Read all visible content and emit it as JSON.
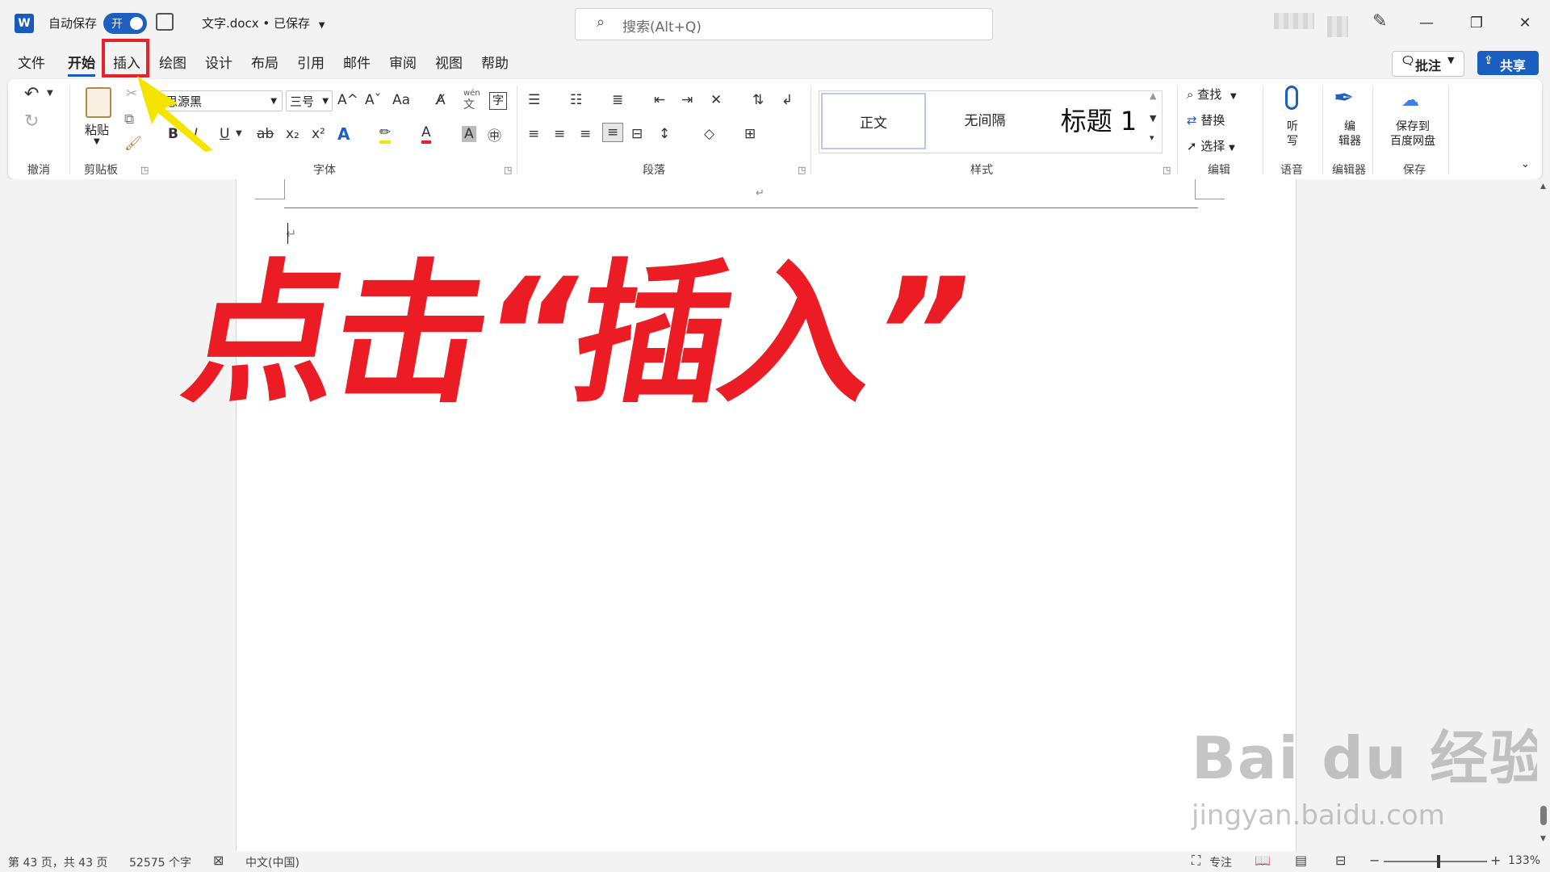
{
  "titlebar": {
    "app_icon": "word-icon",
    "app_icon_letter": "W",
    "autosave_label": "自动保存",
    "autosave_state": "开",
    "doc_title": "文字.docx • 已保存",
    "search_placeholder": "搜索(Alt+Q)",
    "minimize": "—",
    "restore": "❐",
    "close": "✕"
  },
  "tabs": [
    {
      "label": "文件"
    },
    {
      "label": "开始",
      "active": true
    },
    {
      "label": "插入"
    },
    {
      "label": "绘图"
    },
    {
      "label": "设计"
    },
    {
      "label": "布局"
    },
    {
      "label": "引用"
    },
    {
      "label": "邮件"
    },
    {
      "label": "审阅"
    },
    {
      "label": "视图"
    },
    {
      "label": "帮助"
    }
  ],
  "actions": {
    "comments": "批注",
    "share": "共享"
  },
  "ribbon": {
    "groups": {
      "undo": "撤消",
      "clipboard": "剪贴板",
      "font": "字体",
      "paragraph": "段落",
      "styles": "样式",
      "editing": "编辑",
      "voice": "语音",
      "editor": "编辑器",
      "save": "保存"
    },
    "paste_label": "粘贴",
    "font_name": "思源黑",
    "font_size": "三号",
    "grow_font_glyph": "A^",
    "shrink_font_glyph": "Aˇ",
    "change_case_glyph": "Aa",
    "phonetic_top": "wén",
    "phonetic_bottom": "文",
    "bold_glyph": "B",
    "italic_glyph": "I",
    "underline_glyph": "U",
    "strike_glyph": "ab",
    "subscript_glyph": "x₂",
    "superscript_glyph": "x²",
    "text_effect_glyph": "A",
    "font_color_glyph": "A",
    "char_shading_glyph": "A",
    "enclose_glyph": "字",
    "styles": [
      "正文",
      "无间隔",
      "标题 1"
    ],
    "find": "查找",
    "replace": "替换",
    "select": "选择",
    "dictate_l1": "听",
    "dictate_l2": "写",
    "editor_l1": "编",
    "editor_l2": "辑器",
    "save_cloud_l1": "保存到",
    "save_cloud_l2": "百度网盘"
  },
  "document": {
    "headline": "点击“插入”",
    "pilcrow": "↵"
  },
  "statusbar": {
    "page": "第 43 页，共 43 页",
    "words": "52575 个字",
    "language": "中文(中国)",
    "focus": "专注",
    "zoom": "133%",
    "zoom_minus": "−",
    "zoom_plus": "+"
  },
  "watermark": {
    "brand": "Bai du 经验",
    "url": "jingyan.baidu.com"
  },
  "colors": {
    "accent": "#185abd",
    "annotation_red": "#ec1c24",
    "annotation_arrow": "#f5e400"
  }
}
